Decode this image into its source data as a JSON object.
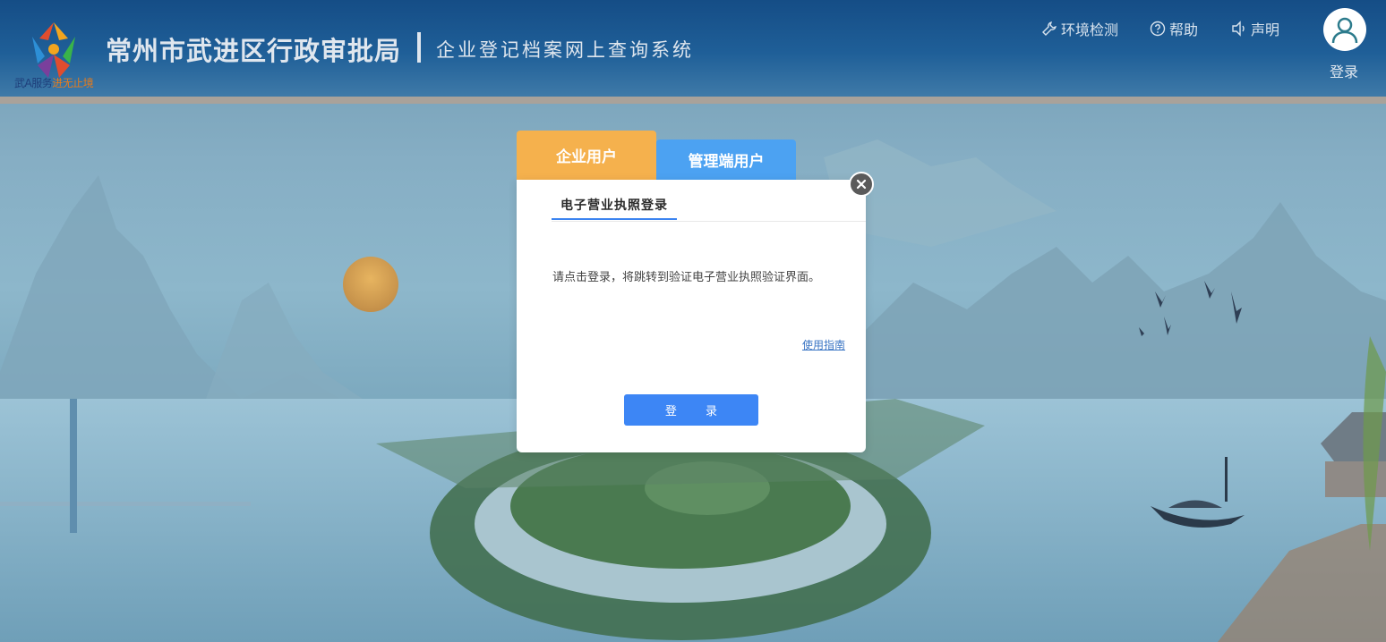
{
  "header": {
    "logo_slogan_a": "武A服务",
    "logo_slogan_b": "进无止境",
    "org_title": "常州市武进区行政审批局",
    "system_title": "企业登记档案网上查询系统",
    "nav": {
      "env_check": "环境检测",
      "help": "帮助",
      "statement": "声明"
    },
    "login_label": "登录"
  },
  "modal": {
    "tabs": {
      "enterprise": "企业用户",
      "admin": "管理端用户"
    },
    "active_tab": "企业用户",
    "subtab": "电子营业执照登录",
    "message": "请点击登录，将跳转到验证电子营业执照验证界面。",
    "guide_link": "使用指南",
    "login_button": "登 录"
  },
  "colors": {
    "header_bg": "#1a5690",
    "tab_enterprise": "#f5b14d",
    "tab_admin": "#4ca2f2",
    "primary_button": "#3d86f5",
    "link": "#3a75c4"
  }
}
